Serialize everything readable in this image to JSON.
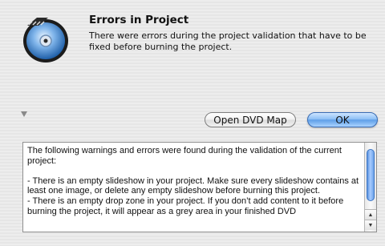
{
  "dialog": {
    "title": "Errors in Project",
    "message": "There were errors during the project validation that have to be fixed before burning the project."
  },
  "buttons": {
    "open_map_label": "Open DVD Map",
    "ok_label": "OK"
  },
  "details": {
    "text": "The following warnings and errors were found during the validation of the current project:\n\n- There is an empty slideshow in your project. Make sure every slideshow contains at least one image, or delete any empty slideshow before burning this project.\n- There is an empty drop zone in your project. If you don’t add content to it before burning the project, it will appear as a grey area in your finished DVD"
  },
  "icons": {
    "app_icon": "idvd-disc-icon",
    "disclosure": "disclosure-triangle-icon",
    "scroll_up": "scroll-up-arrow-icon",
    "scroll_down": "scroll-down-arrow-icon"
  },
  "colors": {
    "ok_button": "#7fb6f2",
    "scroll_thumb": "#6ea3ea"
  }
}
